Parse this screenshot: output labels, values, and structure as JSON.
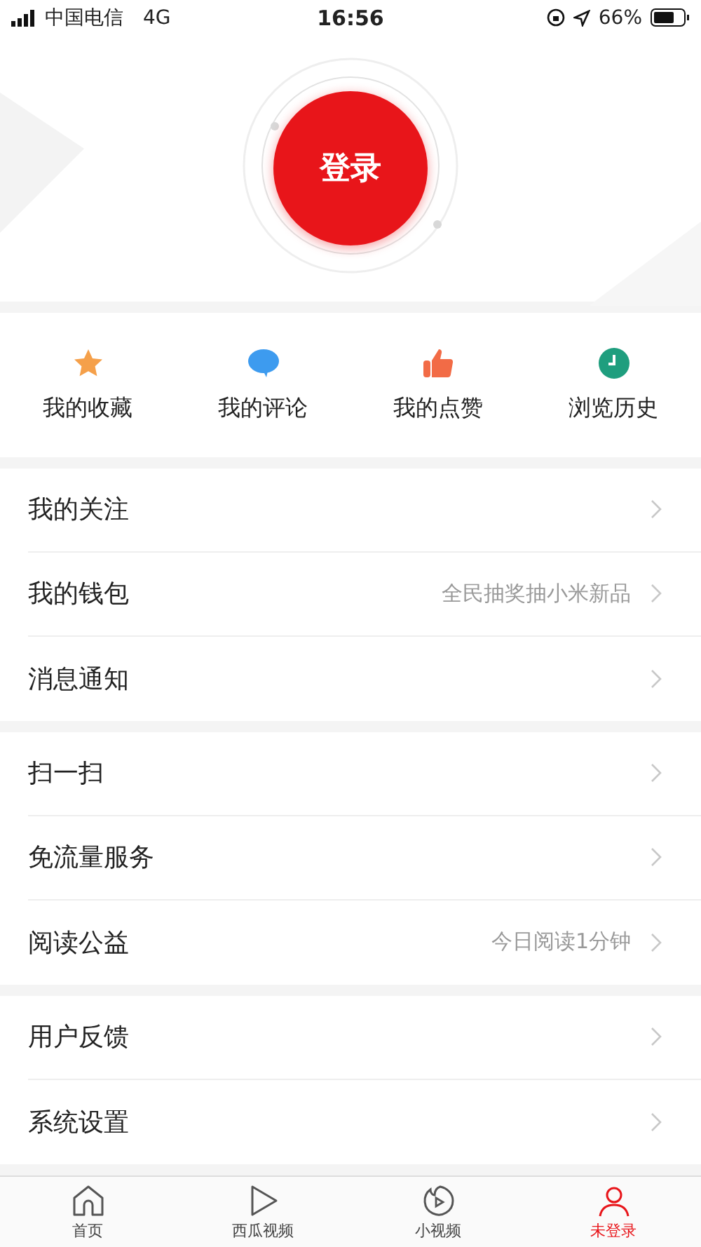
{
  "status_bar": {
    "carrier": "中国电信",
    "network": "4G",
    "time": "16:56",
    "battery": "66%"
  },
  "login_button": {
    "label": "登录"
  },
  "shortcuts": [
    {
      "kind": "star",
      "label": "我的收藏"
    },
    {
      "kind": "comment",
      "label": "我的评论"
    },
    {
      "kind": "like",
      "label": "我的点赞"
    },
    {
      "kind": "history",
      "label": "浏览历史"
    }
  ],
  "sections": [
    [
      {
        "label": "我的关注"
      },
      {
        "label": "我的钱包",
        "note": "全民抽奖抽小米新品"
      },
      {
        "label": "消息通知"
      }
    ],
    [
      {
        "label": "扫一扫"
      },
      {
        "label": "免流量服务"
      },
      {
        "label": "阅读公益",
        "note": "今日阅读1分钟"
      }
    ],
    [
      {
        "label": "用户反馈"
      },
      {
        "label": "系统设置"
      }
    ]
  ],
  "tab_bar": [
    {
      "kind": "home",
      "label": "首页",
      "selected": false
    },
    {
      "kind": "play",
      "label": "西瓜视频",
      "selected": false
    },
    {
      "kind": "short",
      "label": "小视频",
      "selected": false
    },
    {
      "kind": "user",
      "label": "未登录",
      "selected": true
    }
  ]
}
